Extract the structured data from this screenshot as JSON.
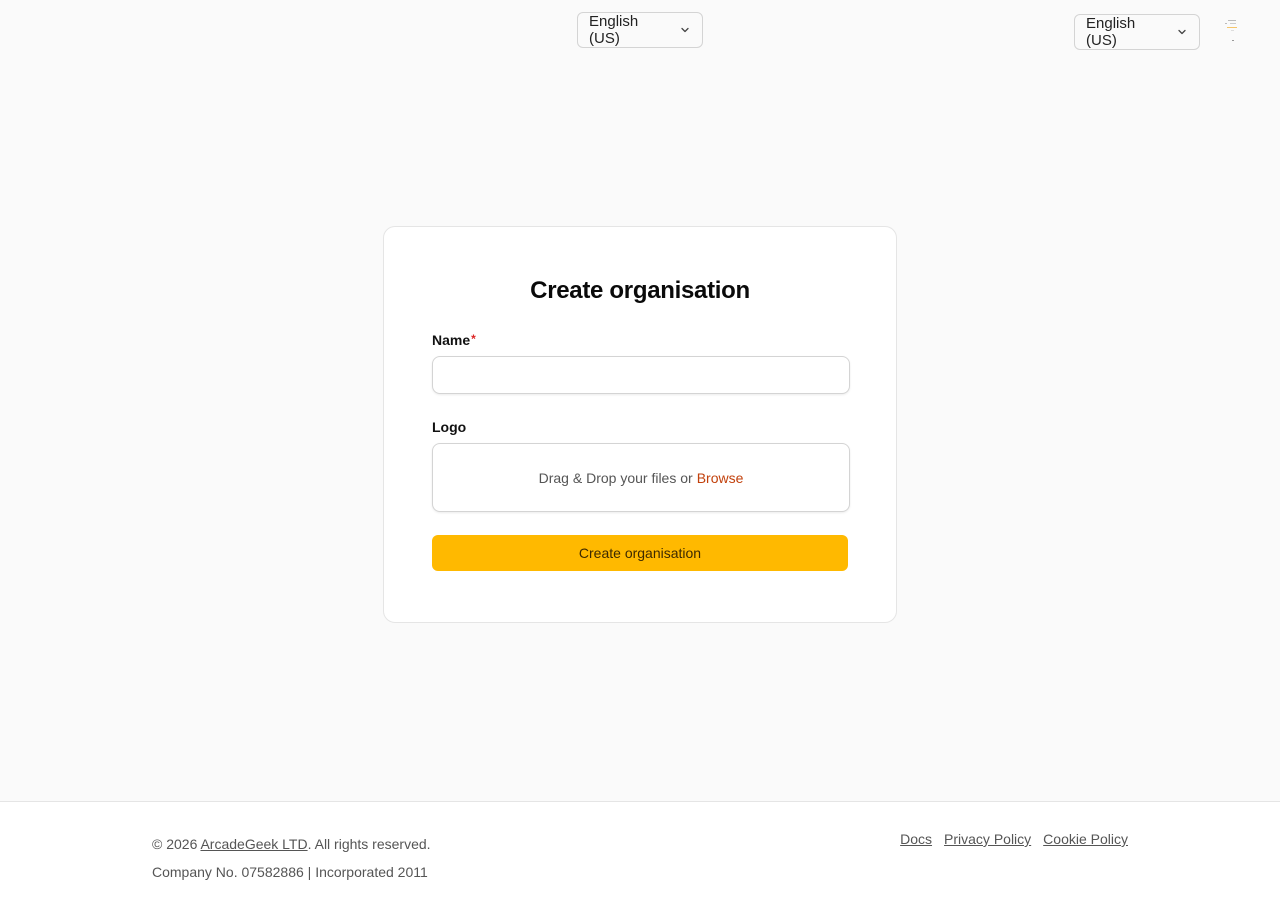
{
  "header": {
    "language_center": "English (US)",
    "language_right": "English (US)"
  },
  "form": {
    "title": "Create organisation",
    "name_label": "Name",
    "name_required_mark": "*",
    "name_value": "",
    "logo_label": "Logo",
    "dropzone_text": "Drag & Drop your files or",
    "dropzone_browse": "Browse",
    "submit_label": "Create organisation"
  },
  "footer": {
    "copyright_prefix": "© 2026 ",
    "company_link": "ArcadeGeek LTD",
    "copyright_suffix": ". All rights reserved.",
    "company_info": "Company No. 07582886 | Incorporated 2011",
    "links": [
      "Docs",
      "Privacy Policy",
      "Cookie Policy"
    ]
  },
  "colors": {
    "accent": "#ffb900",
    "link_accent": "#c2410c",
    "required": "#dc2626",
    "background": "#fafafa"
  }
}
